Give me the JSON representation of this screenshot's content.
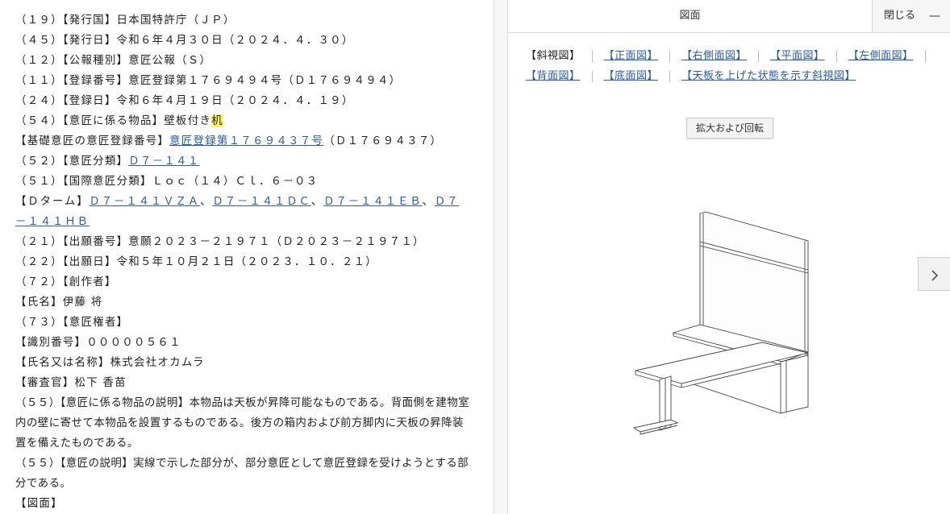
{
  "biblio": {
    "lines": [
      "（１９）【発行国】日本国特許庁（ＪＰ）",
      "（４５）【発行日】令和６年４月３０日（２０２４．４．３０）",
      "（１２）【公報種別】意匠公報（Ｓ）",
      "（１１）【登録番号】意匠登録第１７６９４９４号（Ｄ１７６９４９４）",
      "（２４）【登録日】令和６年４月１９日（２０２４．４．１９）"
    ],
    "article_prefix": "（５４）【意匠に係る物品】壁板付き",
    "article_highlight": "机",
    "base_design_label": "【基礎意匠の意匠登録番号】",
    "base_design_link": "意匠登録第１７６９４３７号",
    "base_design_suffix": "（Ｄ１７６９４３７）",
    "classification_label": "（５２）【意匠分類】",
    "classification_link": "Ｄ７－１４１",
    "intl_class": "（５１）【国際意匠分類】Ｌｏｃ（１４）Ｃｌ．６－０３",
    "dterm_label": "【Ｄターム】",
    "dterm_links": [
      "Ｄ７－１４１ＶＺＡ",
      "Ｄ７－１４１ＤＣ",
      "Ｄ７－１４１ＥＢ",
      "Ｄ７－１４１ＨＢ"
    ],
    "dterm_sep": "、",
    "lines2": [
      "（２１）【出願番号】意願２０２３－２１９７１（Ｄ２０２３－２１９７１）",
      "（２２）【出願日】令和５年１０月２１日（２０２３．１０．２１）",
      "（７２）【創作者】",
      "【氏名】伊藤 将",
      "（７３）【意匠権者】",
      "【識別番号】０００００５６１",
      "【氏名又は名称】株式会社オカムラ",
      "【審査官】松下 香苗"
    ],
    "desc_article": "（５５）【意匠に係る物品の説明】本物品は天板が昇降可能なものである。背面側を建物室内の壁に寄せて本物品を設置するものである。後方の箱内および前方脚内に天板の昇降装置を備えたものである。",
    "desc_design": "（５５）【意匠の説明】実線で示した部分が、部分意匠として意匠登録を受けようとする部分である。",
    "drawing_heading": "【図面】"
  },
  "viewer": {
    "title": "図面",
    "close_label": "閉じる",
    "close_dash": "—",
    "tabs": [
      {
        "label": "【斜視図】",
        "active": true
      },
      {
        "label": "【正面図】",
        "active": false
      },
      {
        "label": "【右側面図】",
        "active": false
      },
      {
        "label": "【平面図】",
        "active": false
      },
      {
        "label": "【左側面図】",
        "active": false
      },
      {
        "label": "【背面図】",
        "active": false
      },
      {
        "label": "【底面図】",
        "active": false
      },
      {
        "label": "【天板を上げた状態を示す斜視図】",
        "active": false
      }
    ],
    "zoom_label": "拡大および回転",
    "next_icon": "chevron-right-icon"
  },
  "colors": {
    "link": "#2a5aa8",
    "highlight": "#fff36a"
  }
}
